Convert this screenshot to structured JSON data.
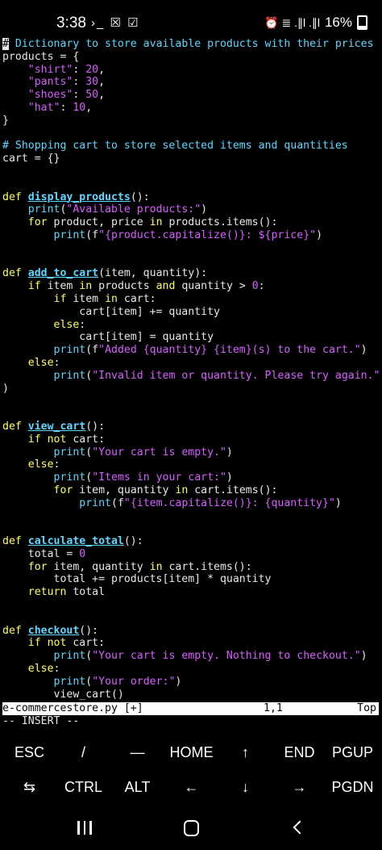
{
  "status_bar": {
    "time": "3:38",
    "left_icons": "›_ ☒ ☑",
    "right_icons": "⏰ ≣ .∥l .∥l",
    "battery": "16%"
  },
  "code_lines": [
    [
      {
        "t": "# Dictionary to store available products with their prices",
        "c": "cm",
        "cursor_first": true
      }
    ],
    [
      {
        "t": "products = {",
        "c": ""
      }
    ],
    [
      {
        "t": "    ",
        "c": ""
      },
      {
        "t": "\"shirt\"",
        "c": "st"
      },
      {
        "t": ": ",
        "c": ""
      },
      {
        "t": "20",
        "c": "nm"
      },
      {
        "t": ",",
        "c": ""
      }
    ],
    [
      {
        "t": "    ",
        "c": ""
      },
      {
        "t": "\"pants\"",
        "c": "st"
      },
      {
        "t": ": ",
        "c": ""
      },
      {
        "t": "30",
        "c": "nm"
      },
      {
        "t": ",",
        "c": ""
      }
    ],
    [
      {
        "t": "    ",
        "c": ""
      },
      {
        "t": "\"shoes\"",
        "c": "st"
      },
      {
        "t": ": ",
        "c": ""
      },
      {
        "t": "50",
        "c": "nm"
      },
      {
        "t": ",",
        "c": ""
      }
    ],
    [
      {
        "t": "    ",
        "c": ""
      },
      {
        "t": "\"hat\"",
        "c": "st"
      },
      {
        "t": ": ",
        "c": ""
      },
      {
        "t": "10",
        "c": "nm"
      },
      {
        "t": ",",
        "c": ""
      }
    ],
    [
      {
        "t": "}",
        "c": ""
      }
    ],
    [],
    [
      {
        "t": "# Shopping cart to store selected items and quantities",
        "c": "cm"
      }
    ],
    [
      {
        "t": "cart = {}",
        "c": ""
      }
    ],
    [],
    [],
    [
      {
        "t": "def ",
        "c": "kw"
      },
      {
        "t": "display_products",
        "c": "fn"
      },
      {
        "t": "():",
        "c": ""
      }
    ],
    [
      {
        "t": "    ",
        "c": ""
      },
      {
        "t": "print",
        "c": "bi"
      },
      {
        "t": "(",
        "c": ""
      },
      {
        "t": "\"Available products:\"",
        "c": "st"
      },
      {
        "t": ")",
        "c": ""
      }
    ],
    [
      {
        "t": "    ",
        "c": ""
      },
      {
        "t": "for",
        "c": "kw"
      },
      {
        "t": " product, price ",
        "c": ""
      },
      {
        "t": "in",
        "c": "kw"
      },
      {
        "t": " products.items():",
        "c": ""
      }
    ],
    [
      {
        "t": "        ",
        "c": ""
      },
      {
        "t": "print",
        "c": "bi"
      },
      {
        "t": "(f",
        "c": ""
      },
      {
        "t": "\"{product.capitalize()}: ${price}\"",
        "c": "st"
      },
      {
        "t": ")",
        "c": ""
      }
    ],
    [],
    [],
    [
      {
        "t": "def ",
        "c": "kw"
      },
      {
        "t": "add_to_cart",
        "c": "fn"
      },
      {
        "t": "(item, quantity):",
        "c": ""
      }
    ],
    [
      {
        "t": "    ",
        "c": ""
      },
      {
        "t": "if",
        "c": "kw"
      },
      {
        "t": " item ",
        "c": ""
      },
      {
        "t": "in",
        "c": "kw"
      },
      {
        "t": " products ",
        "c": ""
      },
      {
        "t": "and",
        "c": "kw"
      },
      {
        "t": " quantity > ",
        "c": ""
      },
      {
        "t": "0",
        "c": "nm"
      },
      {
        "t": ":",
        "c": ""
      }
    ],
    [
      {
        "t": "        ",
        "c": ""
      },
      {
        "t": "if",
        "c": "kw"
      },
      {
        "t": " item ",
        "c": ""
      },
      {
        "t": "in",
        "c": "kw"
      },
      {
        "t": " cart:",
        "c": ""
      }
    ],
    [
      {
        "t": "            cart[item] += quantity",
        "c": ""
      }
    ],
    [
      {
        "t": "        ",
        "c": ""
      },
      {
        "t": "else",
        "c": "kw"
      },
      {
        "t": ":",
        "c": ""
      }
    ],
    [
      {
        "t": "            cart[item] = quantity",
        "c": ""
      }
    ],
    [
      {
        "t": "        ",
        "c": ""
      },
      {
        "t": "print",
        "c": "bi"
      },
      {
        "t": "(f",
        "c": ""
      },
      {
        "t": "\"Added {quantity} {item}(s) to the cart.\"",
        "c": "st"
      },
      {
        "t": ")",
        "c": ""
      }
    ],
    [
      {
        "t": "    ",
        "c": ""
      },
      {
        "t": "else",
        "c": "kw"
      },
      {
        "t": ":",
        "c": ""
      }
    ],
    [
      {
        "t": "        ",
        "c": ""
      },
      {
        "t": "print",
        "c": "bi"
      },
      {
        "t": "(",
        "c": ""
      },
      {
        "t": "\"Invalid item or quantity. Please try again.\"",
        "c": "st"
      }
    ],
    [
      {
        "t": ")",
        "c": ""
      }
    ],
    [],
    [],
    [
      {
        "t": "def ",
        "c": "kw"
      },
      {
        "t": "view_cart",
        "c": "fn"
      },
      {
        "t": "():",
        "c": ""
      }
    ],
    [
      {
        "t": "    ",
        "c": ""
      },
      {
        "t": "if not",
        "c": "kw"
      },
      {
        "t": " cart:",
        "c": ""
      }
    ],
    [
      {
        "t": "        ",
        "c": ""
      },
      {
        "t": "print",
        "c": "bi"
      },
      {
        "t": "(",
        "c": ""
      },
      {
        "t": "\"Your cart is empty.\"",
        "c": "st"
      },
      {
        "t": ")",
        "c": ""
      }
    ],
    [
      {
        "t": "    ",
        "c": ""
      },
      {
        "t": "else",
        "c": "kw"
      },
      {
        "t": ":",
        "c": ""
      }
    ],
    [
      {
        "t": "        ",
        "c": ""
      },
      {
        "t": "print",
        "c": "bi"
      },
      {
        "t": "(",
        "c": ""
      },
      {
        "t": "\"Items in your cart:\"",
        "c": "st"
      },
      {
        "t": ")",
        "c": ""
      }
    ],
    [
      {
        "t": "        ",
        "c": ""
      },
      {
        "t": "for",
        "c": "kw"
      },
      {
        "t": " item, quantity ",
        "c": ""
      },
      {
        "t": "in",
        "c": "kw"
      },
      {
        "t": " cart.items():",
        "c": ""
      }
    ],
    [
      {
        "t": "            ",
        "c": ""
      },
      {
        "t": "print",
        "c": "bi"
      },
      {
        "t": "(f",
        "c": ""
      },
      {
        "t": "\"{item.capitalize()}: {quantity}\"",
        "c": "st"
      },
      {
        "t": ")",
        "c": ""
      }
    ],
    [],
    [],
    [
      {
        "t": "def ",
        "c": "kw"
      },
      {
        "t": "calculate_total",
        "c": "fn"
      },
      {
        "t": "():",
        "c": ""
      }
    ],
    [
      {
        "t": "    total = ",
        "c": ""
      },
      {
        "t": "0",
        "c": "nm"
      }
    ],
    [
      {
        "t": "    ",
        "c": ""
      },
      {
        "t": "for",
        "c": "kw"
      },
      {
        "t": " item, quantity ",
        "c": ""
      },
      {
        "t": "in",
        "c": "kw"
      },
      {
        "t": " cart.items():",
        "c": ""
      }
    ],
    [
      {
        "t": "        total += products[item] * quantity",
        "c": ""
      }
    ],
    [
      {
        "t": "    ",
        "c": ""
      },
      {
        "t": "return",
        "c": "kw"
      },
      {
        "t": " total",
        "c": ""
      }
    ],
    [],
    [],
    [
      {
        "t": "def ",
        "c": "kw"
      },
      {
        "t": "checkout",
        "c": "fn"
      },
      {
        "t": "():",
        "c": ""
      }
    ],
    [
      {
        "t": "    ",
        "c": ""
      },
      {
        "t": "if not",
        "c": "kw"
      },
      {
        "t": " cart:",
        "c": ""
      }
    ],
    [
      {
        "t": "        ",
        "c": ""
      },
      {
        "t": "print",
        "c": "bi"
      },
      {
        "t": "(",
        "c": ""
      },
      {
        "t": "\"Your cart is empty. Nothing to checkout.\"",
        "c": "st"
      },
      {
        "t": ")",
        "c": ""
      }
    ],
    [
      {
        "t": "    ",
        "c": ""
      },
      {
        "t": "else",
        "c": "kw"
      },
      {
        "t": ":",
        "c": ""
      }
    ],
    [
      {
        "t": "        ",
        "c": ""
      },
      {
        "t": "print",
        "c": "bi"
      },
      {
        "t": "(",
        "c": ""
      },
      {
        "t": "\"Your order:\"",
        "c": "st"
      },
      {
        "t": ")",
        "c": ""
      }
    ],
    [
      {
        "t": "        view_cart()",
        "c": ""
      }
    ]
  ],
  "vim": {
    "filename": "e-commercestore.py [+]",
    "position": "1,1",
    "scroll": "Top",
    "mode": "-- INSERT --"
  },
  "extra_keys": {
    "row1": [
      "ESC",
      "/",
      "—",
      "HOME",
      "↑",
      "END",
      "PGUP"
    ],
    "row2": [
      "⇆",
      "CTRL",
      "ALT",
      "←",
      "↓",
      "→",
      "PGDN"
    ]
  },
  "colors": {
    "comment": "#5fd7ff",
    "keyword": "#ffff5f",
    "string": "#d75fff",
    "background": "#000000"
  }
}
